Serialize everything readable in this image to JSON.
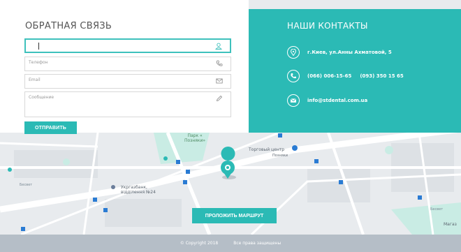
{
  "form": {
    "title": "ОБРАТНАЯ СВЯЗЬ",
    "phone_placeholder": "Телефон",
    "email_placeholder": "Email",
    "message_placeholder": "Сообщение",
    "submit_label": "ОТПРАВИТЬ"
  },
  "contacts": {
    "title": "НАШИ КОНТАКТЫ",
    "address": "г.Киев, ул.Анны Ахматовой, 5",
    "phone_1": "(066) 006-15-65",
    "phone_2": "(093) 350 15 65",
    "email": "info@stdental.com.ua"
  },
  "map": {
    "park_label_1": "Парк «",
    "park_label_2": "Позняки»",
    "mall_label": "Торговый центр",
    "mall_sub": "Позняки",
    "bank_label_1": "Укргазбанк,",
    "bank_label_2": "відділення №24",
    "besvt_1": "Бесвет",
    "besvt_2": "Бесвет",
    "magaz": "Магаз",
    "route_label": "ПРОЛОЖИТЬ МАРШРУТ"
  },
  "footer": {
    "copyright": "© Copyright 2018",
    "rights": "Все права защищены"
  },
  "colors": {
    "accent": "#2bbab5",
    "footer": "#b5bec7"
  },
  "icons": [
    "user-icon",
    "phone-icon",
    "mail-icon",
    "pencil-icon",
    "location-pin-icon",
    "map-marker-icon"
  ]
}
